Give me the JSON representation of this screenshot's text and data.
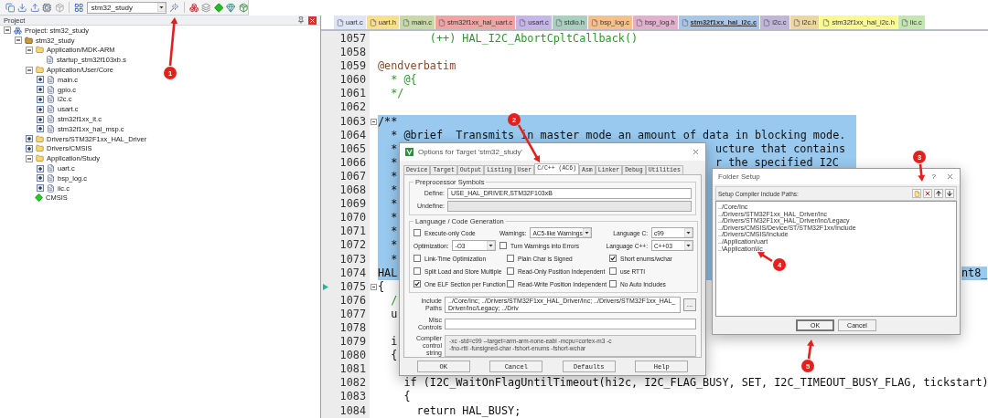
{
  "toolbar": {
    "target": "stm32_study"
  },
  "project_panel": {
    "title": "Project",
    "tree": [
      {
        "label": "Project: stm32_study",
        "kind": "project",
        "expanded": true,
        "children": [
          {
            "label": "stm32_study",
            "kind": "target",
            "expanded": true,
            "children": [
              {
                "label": "Application/MDK-ARM",
                "kind": "folder",
                "expanded": true,
                "children": [
                  {
                    "label": "startup_stm32f103xb.s",
                    "kind": "file"
                  }
                ]
              },
              {
                "label": "Application/User/Core",
                "kind": "folder",
                "expanded": true,
                "children": [
                  {
                    "label": "main.c",
                    "kind": "file",
                    "expanded": false
                  },
                  {
                    "label": "gpio.c",
                    "kind": "file",
                    "expanded": false
                  },
                  {
                    "label": "i2c.c",
                    "kind": "file",
                    "expanded": false
                  },
                  {
                    "label": "usart.c",
                    "kind": "file",
                    "expanded": false
                  },
                  {
                    "label": "stm32f1xx_it.c",
                    "kind": "file",
                    "expanded": false
                  },
                  {
                    "label": "stm32f1xx_hal_msp.c",
                    "kind": "file",
                    "expanded": false
                  }
                ]
              },
              {
                "label": "Drivers/STM32F1xx_HAL_Driver",
                "kind": "folder",
                "expanded": false
              },
              {
                "label": "Drivers/CMSIS",
                "kind": "folder",
                "expanded": false
              },
              {
                "label": "Application/Study",
                "kind": "folder",
                "expanded": true,
                "children": [
                  {
                    "label": "uart.c",
                    "kind": "file",
                    "expanded": false
                  },
                  {
                    "label": "bsp_log.c",
                    "kind": "file",
                    "expanded": false
                  },
                  {
                    "label": "iic.c",
                    "kind": "file",
                    "expanded": false
                  }
                ]
              },
              {
                "label": "CMSIS",
                "kind": "component"
              }
            ]
          }
        ]
      }
    ]
  },
  "editor_tabs": [
    {
      "label": "uart.c",
      "color": "#dfe4f7",
      "selected": false
    },
    {
      "label": "uart.h",
      "color": "#f9e08c",
      "selected": false
    },
    {
      "label": "main.c",
      "color": "#c8d8a8",
      "selected": false
    },
    {
      "label": "stm32f1xx_hal_uart.c",
      "color": "#f0a4a4",
      "selected": false
    },
    {
      "label": "usart.c",
      "color": "#c6b6e8",
      "selected": false
    },
    {
      "label": "stdio.h",
      "color": "#a8cfc0",
      "selected": false
    },
    {
      "label": "bsp_log.c",
      "color": "#f6c08a",
      "selected": false
    },
    {
      "label": "bsp_log.h",
      "color": "#e0b0cc",
      "selected": false
    },
    {
      "label": "stm32f1xx_hal_i2c.c",
      "color": "#a9c6e6",
      "selected": true
    },
    {
      "label": "i2c.c",
      "color": "#c0b6d8",
      "selected": false
    },
    {
      "label": "i2c.h",
      "color": "#eed6a0",
      "selected": false
    },
    {
      "label": "stm32f1xx_hal_i2c.h",
      "color": "#fafa90",
      "selected": false
    },
    {
      "label": "iic.c",
      "color": "#c4e6b0",
      "selected": false
    }
  ],
  "code_lines": [
    {
      "number": "1057",
      "kind": "comment",
      "text": "        (++) HAL_I2C_AbortCpltCallback()",
      "selected": false,
      "fold": false,
      "current": false
    },
    {
      "number": "1058",
      "selected": false,
      "fold": false,
      "current": false
    },
    {
      "number": "1059",
      "kind": "doc",
      "text": "@endverbatim",
      "selected": false,
      "fold": false,
      "current": false
    },
    {
      "number": "1060",
      "kind": "comment",
      "text": "  * @{",
      "selected": false,
      "fold": false,
      "current": false
    },
    {
      "number": "1061",
      "kind": "comment",
      "text": "  */",
      "selected": false,
      "fold": false,
      "current": false
    },
    {
      "number": "1062",
      "selected": false,
      "fold": false,
      "current": false
    },
    {
      "number": "1063",
      "kind": "comment",
      "text": "/**",
      "selected": true,
      "fold": true,
      "current": false
    },
    {
      "number": "1064",
      "kind": "comment",
      "text": "  * @brief  Transmits in master mode an amount of data in blocking mode.",
      "selected": true,
      "fold": false,
      "current": false
    },
    {
      "number": "1065",
      "kind": "comment",
      "text": "  *",
      "middle_text": "ucture that contains",
      "selected": true,
      "fold": false,
      "current": false
    },
    {
      "number": "1066",
      "kind": "comment",
      "text": "  *",
      "middle_text": "r the specified I2C",
      "selected": true,
      "fold": false,
      "current": false
    },
    {
      "number": "1067",
      "kind": "comment",
      "text": "  *",
      "selected": true,
      "fold": false,
      "current": false
    },
    {
      "number": "1068",
      "kind": "comment",
      "text": "  *",
      "selected": true,
      "fold": false,
      "current": false
    },
    {
      "number": "1069",
      "kind": "comment",
      "text": "  *",
      "selected": true,
      "fold": false,
      "current": false
    },
    {
      "number": "1070",
      "kind": "comment",
      "text": "  *",
      "selected": true,
      "fold": false,
      "current": false
    },
    {
      "number": "1071",
      "kind": "comment",
      "text": "  *",
      "selected": true,
      "fold": false,
      "current": false
    },
    {
      "number": "1072",
      "kind": "comment",
      "text": "  *",
      "selected": true,
      "fold": false,
      "current": false
    },
    {
      "number": "1073",
      "kind": "comment",
      "text": "  *",
      "selected": true,
      "fold": false,
      "current": false
    },
    {
      "number": "1074",
      "kind": "code",
      "text": "HAL",
      "end_text": "nt8_",
      "selected": true,
      "fold": false,
      "current": false
    },
    {
      "number": "1075",
      "kind": "code",
      "text": "{",
      "selected": false,
      "fold": true,
      "current": true
    },
    {
      "number": "1076",
      "kind": "comment",
      "text": "  /",
      "selected": false,
      "fold": false,
      "current": false
    },
    {
      "number": "1077",
      "kind": "code",
      "text": "  u",
      "selected": false,
      "fold": false,
      "current": false
    },
    {
      "number": "1078",
      "selected": false,
      "fold": false,
      "current": false
    },
    {
      "number": "1079",
      "kind": "code",
      "text": "  i",
      "selected": false,
      "fold": false,
      "current": false
    },
    {
      "number": "1080",
      "kind": "code",
      "text": "  {",
      "selected": false,
      "fold": false,
      "current": false
    },
    {
      "number": "1081",
      "selected": false,
      "fold": false,
      "current": false
    },
    {
      "number": "1082",
      "kind": "code",
      "text": "    if (I2C_WaitOnFlagUntilTimeout(hi2c, I2C_FLAG_BUSY, SET, I2C_TIMEOUT_BUSY_FLAG, tickstart)",
      "selected": false,
      "fold": false,
      "current": false
    },
    {
      "number": "1083",
      "kind": "code",
      "text": "    {",
      "selected": false,
      "fold": false,
      "current": false
    },
    {
      "number": "1084",
      "kind": "code",
      "text": "      return HAL_BUSY;",
      "selected": false,
      "fold": false,
      "current": false
    }
  ],
  "options_dialog": {
    "title": "Options for Target 'stm32_study'",
    "tabs": [
      {
        "label": "Device",
        "selected": false
      },
      {
        "label": "Target",
        "selected": false
      },
      {
        "label": "Output",
        "selected": false
      },
      {
        "label": "Listing",
        "selected": false
      },
      {
        "label": "User",
        "selected": false
      },
      {
        "label": "C/C++ (AC6)",
        "selected": true
      },
      {
        "label": "Asm",
        "selected": false
      },
      {
        "label": "Linker",
        "selected": false
      },
      {
        "label": "Debug",
        "selected": false
      },
      {
        "label": "Utilities",
        "selected": false
      }
    ],
    "preprocessor": {
      "title": "Preprocessor Symbols",
      "fields": [
        {
          "label": "Define:",
          "value": "USE_HAL_DRIVER,STM32F103xB",
          "disabled": false
        },
        {
          "label": "Undefine:",
          "disabled": true
        }
      ]
    },
    "code_generation": {
      "title": "Language / Code Generation",
      "items": [
        {
          "kind": "checkbox",
          "label": "Execute-only Code",
          "checked": false
        },
        {
          "kind": "select",
          "label": "Warnings:",
          "value": "AC5-like Warnings"
        },
        {
          "kind": "select",
          "label": "Language C:",
          "value": "c99"
        },
        {
          "kind": "select",
          "label": "Optimization:",
          "value": "-O3"
        },
        {
          "kind": "checkbox",
          "label": "Turn Warnings into Errors",
          "checked": false
        },
        {
          "kind": "select",
          "label": "Language C++:",
          "value": "C++03"
        },
        {
          "kind": "checkbox",
          "label": "Link-Time Optimization",
          "checked": false
        },
        {
          "kind": "checkbox",
          "label": "Plain Char is Signed",
          "checked": false
        },
        {
          "kind": "checkbox",
          "label": "Short enums/wchar",
          "checked": true
        },
        {
          "kind": "checkbox",
          "label": "Split Load and Store Multiple",
          "checked": false
        },
        {
          "kind": "checkbox",
          "label": "Read-Only Position Independent",
          "checked": false
        },
        {
          "kind": "checkbox",
          "label": "use RTTI",
          "checked": false
        },
        {
          "kind": "checkbox",
          "label": "One ELF Section per Function",
          "checked": true
        },
        {
          "kind": "checkbox",
          "label": "Read-Write Position Independent",
          "checked": false
        },
        {
          "kind": "checkbox",
          "label": "No Auto Includes",
          "checked": false
        }
      ]
    },
    "include_paths": {
      "label": "Include Paths",
      "value": "../Core/Inc; ../Drivers/STM32F1xx_HAL_Driver/Inc; ../Drivers/STM32F1xx_HAL_Driver/Inc/Legacy; ../Driv",
      "browse": "..."
    },
    "misc_controls": {
      "label": "Misc Controls"
    },
    "compiler_control_string": {
      "label": "Compiler control string",
      "lines": [
        "-xc -std=c99 --target=arm-arm-none-eabi -mcpu=cortex-m3 -c",
        "-fno-rtti -funsigned-char -fshort-enums -fshort-wchar"
      ]
    },
    "buttons": [
      "OK",
      "Cancel",
      "Defaults",
      "Help"
    ]
  },
  "folder_dialog": {
    "title": "Folder Setup",
    "help": "?",
    "list_label": "Setup Compiler Include Paths:",
    "paths": [
      "../Core/Inc",
      "../Drivers/STM32F1xx_HAL_Driver/Inc",
      "../Drivers/STM32F1xx_HAL_Driver/Inc/Legacy",
      "../Drivers/CMSIS/Device/ST/STM32F1xx/Include",
      "../Drivers/CMSIS/Include",
      "../Application/uart",
      "..\\Application\\iic"
    ],
    "buttons": [
      "OK",
      "Cancel"
    ]
  },
  "annotations": [
    {
      "label": "1"
    },
    {
      "label": "2"
    },
    {
      "label": "3"
    },
    {
      "label": "4"
    },
    {
      "label": "5"
    }
  ]
}
